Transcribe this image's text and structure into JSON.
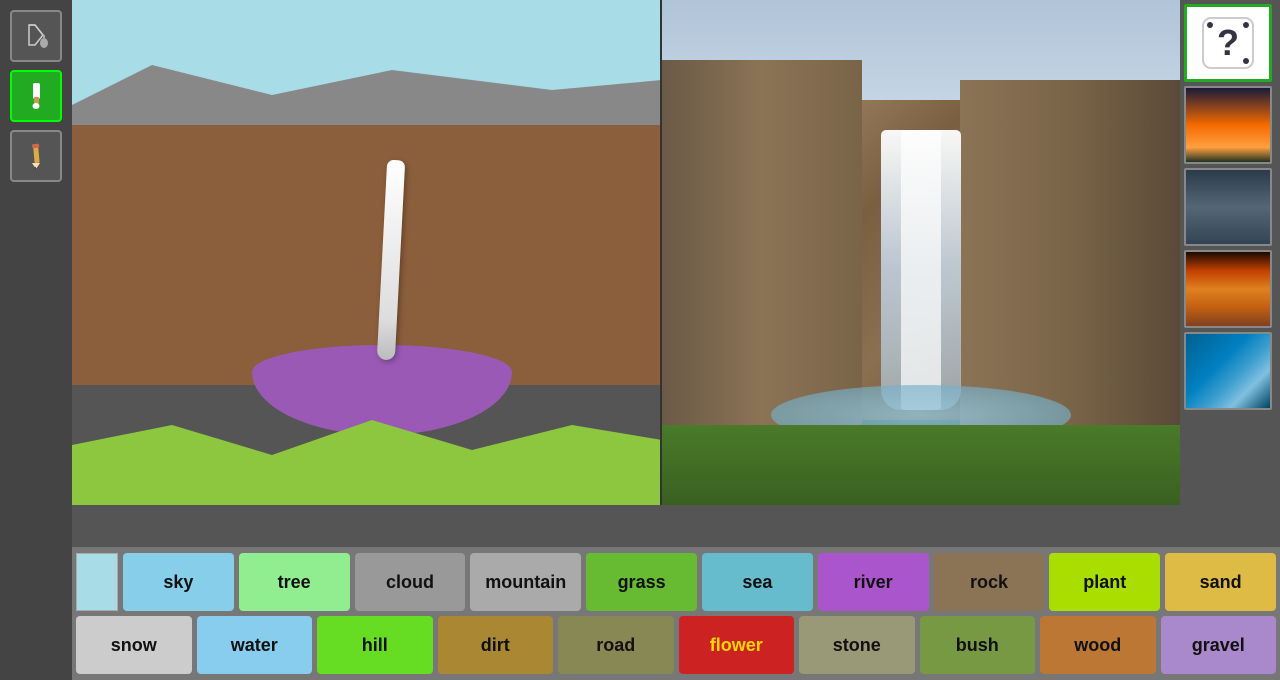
{
  "toolbar": {
    "tools": [
      {
        "name": "paint-bucket",
        "icon": "🪣",
        "active": false
      },
      {
        "name": "brush",
        "icon": "🖌️",
        "active": true
      },
      {
        "name": "pencil",
        "icon": "✏️",
        "active": false
      }
    ]
  },
  "thumbnails": [
    {
      "name": "random-dice",
      "type": "dice",
      "active": true
    },
    {
      "name": "sunset-landscape",
      "type": "sunset",
      "active": false
    },
    {
      "name": "cloudy-sky",
      "type": "clouds",
      "active": false
    },
    {
      "name": "desert-sunset",
      "type": "desert",
      "active": false
    },
    {
      "name": "ocean-wave",
      "type": "wave",
      "active": false
    }
  ],
  "labels_row1": [
    {
      "label": "sky",
      "color": "#87CEEB",
      "text_color": "#111"
    },
    {
      "label": "tree",
      "color": "#90EE90",
      "text_color": "#111"
    },
    {
      "label": "cloud",
      "color": "#999",
      "text_color": "#111"
    },
    {
      "label": "mountain",
      "color": "#aaa",
      "text_color": "#111"
    },
    {
      "label": "grass",
      "color": "#66BB33",
      "text_color": "#111"
    },
    {
      "label": "sea",
      "color": "#66BBCC",
      "text_color": "#111"
    },
    {
      "label": "river",
      "color": "#AA55CC",
      "text_color": "#111"
    },
    {
      "label": "rock",
      "color": "#8B7355",
      "text_color": "#111"
    },
    {
      "label": "plant",
      "color": "#AADD00",
      "text_color": "#111"
    },
    {
      "label": "sand",
      "color": "#DDBB44",
      "text_color": "#111"
    }
  ],
  "labels_row2": [
    {
      "label": "snow",
      "color": "#CCCCCC",
      "text_color": "#111"
    },
    {
      "label": "water",
      "color": "#88CCEE",
      "text_color": "#111"
    },
    {
      "label": "hill",
      "color": "#66DD22",
      "text_color": "#111"
    },
    {
      "label": "dirt",
      "color": "#AA8833",
      "text_color": "#111"
    },
    {
      "label": "road",
      "color": "#888855",
      "text_color": "#111"
    },
    {
      "label": "flower",
      "color": "#CC2222",
      "text_color": "#FFD700"
    },
    {
      "label": "stone",
      "color": "#999977",
      "text_color": "#111"
    },
    {
      "label": "bush",
      "color": "#779944",
      "text_color": "#111"
    },
    {
      "label": "wood",
      "color": "#BB7733",
      "text_color": "#111"
    },
    {
      "label": "gravel",
      "color": "#AA88CC",
      "text_color": "#111"
    }
  ],
  "swatch_color": "#a8dde8"
}
